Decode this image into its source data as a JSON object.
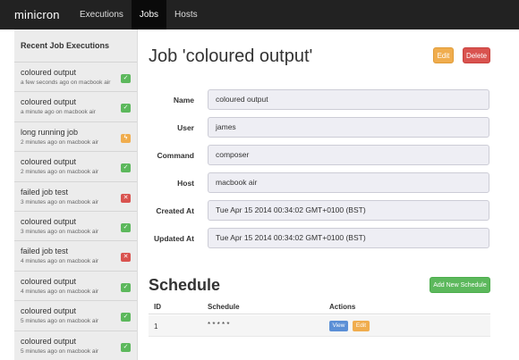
{
  "navbar": {
    "brand": "minicron",
    "links": [
      "Executions",
      "Jobs",
      "Hosts"
    ],
    "active": "Jobs"
  },
  "sidebar": {
    "header": "Recent Job Executions",
    "items": [
      {
        "title": "coloured output",
        "meta": "a few seconds ago on macbook air",
        "status": "success",
        "icon": "check-icon"
      },
      {
        "title": "coloured output",
        "meta": "a minute ago on macbook air",
        "status": "success",
        "icon": "check-icon"
      },
      {
        "title": "long running job",
        "meta": "2 minutes ago on macbook air",
        "status": "running",
        "icon": "bolt-icon"
      },
      {
        "title": "coloured output",
        "meta": "2 minutes ago on macbook air",
        "status": "success",
        "icon": "check-icon"
      },
      {
        "title": "failed job test",
        "meta": "3 minutes ago on macbook air",
        "status": "failed",
        "icon": "cross-icon"
      },
      {
        "title": "coloured output",
        "meta": "3 minutes ago on macbook air",
        "status": "success",
        "icon": "check-icon"
      },
      {
        "title": "failed job test",
        "meta": "4 minutes ago on macbook air",
        "status": "failed",
        "icon": "cross-icon"
      },
      {
        "title": "coloured output",
        "meta": "4 minutes ago on macbook air",
        "status": "success",
        "icon": "check-icon"
      },
      {
        "title": "coloured output",
        "meta": "5 minutes ago on macbook air",
        "status": "success",
        "icon": "check-icon"
      },
      {
        "title": "coloured output",
        "meta": "5 minutes ago on macbook air",
        "status": "success",
        "icon": "check-icon"
      }
    ]
  },
  "job": {
    "title": "Job 'coloured output'",
    "edit_label": "Edit",
    "delete_label": "Delete",
    "fields": [
      {
        "label": "Name",
        "value": "coloured output"
      },
      {
        "label": "User",
        "value": "james"
      },
      {
        "label": "Command",
        "value": "composer"
      },
      {
        "label": "Host",
        "value": "macbook air"
      },
      {
        "label": "Created At",
        "value": "Tue Apr 15 2014 00:34:02 GMT+0100 (BST)"
      },
      {
        "label": "Updated At",
        "value": "Tue Apr 15 2014 00:34:02 GMT+0100 (BST)"
      }
    ]
  },
  "schedule": {
    "title": "Schedule",
    "add_label": "Add New Schedule",
    "columns": [
      "ID",
      "Schedule",
      "Actions"
    ],
    "rows": [
      {
        "id": "1",
        "schedule": "* * * * *",
        "view_label": "View",
        "edit_label": "Edit"
      }
    ]
  },
  "colors": {
    "success": "#5cb85c",
    "warning": "#f0ad4e",
    "danger": "#d9534f",
    "info": "#5b8fd6",
    "navbar": "#222222"
  }
}
